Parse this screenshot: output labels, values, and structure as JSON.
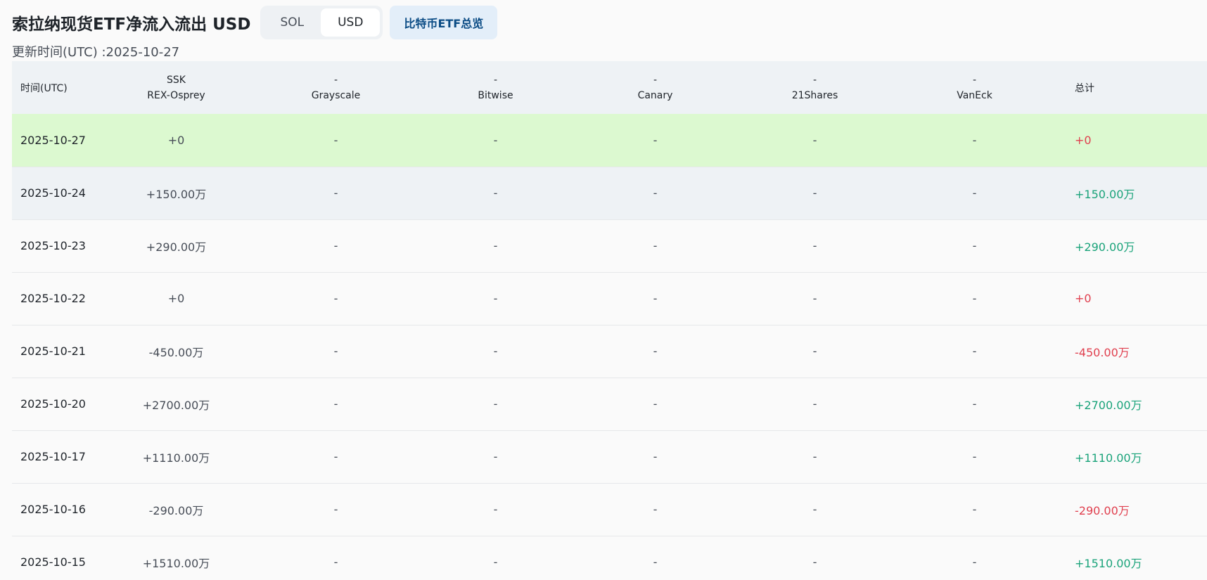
{
  "header": {
    "title": "索拉纳现货ETF净流入流出 USD",
    "toggle": {
      "sol_label": "SOL",
      "usd_label": "USD",
      "active": "USD"
    },
    "overview_button_label": "比特币ETF总览",
    "updated_label": "更新时间(UTC) :2025-10-27"
  },
  "colors": {
    "positive": "#1aa37a",
    "negative": "#e03f4e",
    "highlight_row": "#dcf9d0",
    "header_bg": "#eef2f5",
    "overview_button_bg": "#e3eef9",
    "overview_button_text": "#0b4c85"
  },
  "table": {
    "columns": [
      {
        "ticker": "",
        "name": "时间(UTC)"
      },
      {
        "ticker": "SSK",
        "name": "REX-Osprey"
      },
      {
        "ticker": "-",
        "name": "Grayscale"
      },
      {
        "ticker": "-",
        "name": "Bitwise"
      },
      {
        "ticker": "-",
        "name": "Canary"
      },
      {
        "ticker": "-",
        "name": "21Shares"
      },
      {
        "ticker": "-",
        "name": "VanEck"
      },
      {
        "ticker": "",
        "name": "总计"
      }
    ],
    "rows": [
      {
        "date": "2025-10-27",
        "ssk": "+0",
        "grayscale": "-",
        "bitwise": "-",
        "canary": "-",
        "shares21": "-",
        "vaneck": "-",
        "total": "+0",
        "sign": "neg",
        "style": "highlight"
      },
      {
        "date": "2025-10-24",
        "ssk": "+150.00万",
        "grayscale": "-",
        "bitwise": "-",
        "canary": "-",
        "shares21": "-",
        "vaneck": "-",
        "total": "+150.00万",
        "sign": "pos",
        "style": "shaded"
      },
      {
        "date": "2025-10-23",
        "ssk": "+290.00万",
        "grayscale": "-",
        "bitwise": "-",
        "canary": "-",
        "shares21": "-",
        "vaneck": "-",
        "total": "+290.00万",
        "sign": "pos",
        "style": ""
      },
      {
        "date": "2025-10-22",
        "ssk": "+0",
        "grayscale": "-",
        "bitwise": "-",
        "canary": "-",
        "shares21": "-",
        "vaneck": "-",
        "total": "+0",
        "sign": "neg",
        "style": ""
      },
      {
        "date": "2025-10-21",
        "ssk": "-450.00万",
        "grayscale": "-",
        "bitwise": "-",
        "canary": "-",
        "shares21": "-",
        "vaneck": "-",
        "total": "-450.00万",
        "sign": "neg",
        "style": ""
      },
      {
        "date": "2025-10-20",
        "ssk": "+2700.00万",
        "grayscale": "-",
        "bitwise": "-",
        "canary": "-",
        "shares21": "-",
        "vaneck": "-",
        "total": "+2700.00万",
        "sign": "pos",
        "style": ""
      },
      {
        "date": "2025-10-17",
        "ssk": "+1110.00万",
        "grayscale": "-",
        "bitwise": "-",
        "canary": "-",
        "shares21": "-",
        "vaneck": "-",
        "total": "+1110.00万",
        "sign": "pos",
        "style": ""
      },
      {
        "date": "2025-10-16",
        "ssk": "-290.00万",
        "grayscale": "-",
        "bitwise": "-",
        "canary": "-",
        "shares21": "-",
        "vaneck": "-",
        "total": "-290.00万",
        "sign": "neg",
        "style": ""
      },
      {
        "date": "2025-10-15",
        "ssk": "+1510.00万",
        "grayscale": "-",
        "bitwise": "-",
        "canary": "-",
        "shares21": "-",
        "vaneck": "-",
        "total": "+1510.00万",
        "sign": "pos",
        "style": ""
      }
    ]
  }
}
